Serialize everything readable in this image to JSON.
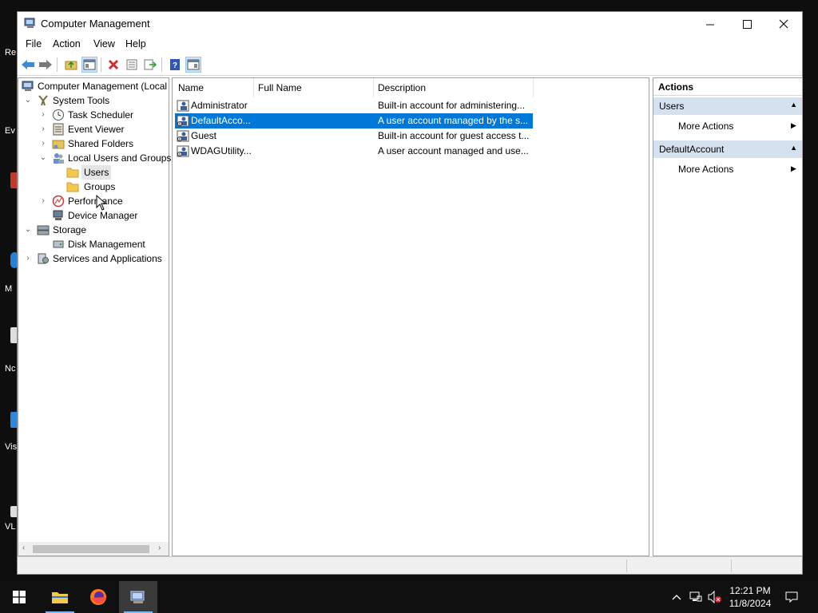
{
  "desktop": {
    "labels": [
      "Re",
      "Ev",
      "M",
      "Nc",
      "Vis",
      "VL"
    ]
  },
  "window": {
    "title": "Computer Management",
    "controls": {
      "minimize": "—",
      "maximize": "☐",
      "close": "✕"
    }
  },
  "menu": [
    "File",
    "Action",
    "View",
    "Help"
  ],
  "tree": {
    "root": "Computer Management (Local",
    "system_tools": "System Tools",
    "task_scheduler": "Task Scheduler",
    "event_viewer": "Event Viewer",
    "shared_folders": "Shared Folders",
    "local_users_groups": "Local Users and Groups",
    "users": "Users",
    "groups": "Groups",
    "performance": "Performance",
    "device_manager": "Device Manager",
    "storage": "Storage",
    "disk_management": "Disk Management",
    "services_apps": "Services and Applications"
  },
  "list": {
    "columns": {
      "name": "Name",
      "full_name": "Full Name",
      "description": "Description"
    },
    "rows": [
      {
        "name": "Administrator",
        "full_name": "",
        "description": "Built-in account for administering...",
        "selected": false
      },
      {
        "name": "DefaultAcco...",
        "full_name": "",
        "description": "A user account managed by the s...",
        "selected": true
      },
      {
        "name": "Guest",
        "full_name": "",
        "description": "Built-in account for guest access t...",
        "selected": false
      },
      {
        "name": "WDAGUtility...",
        "full_name": "",
        "description": "A user account managed and use...",
        "selected": false
      }
    ]
  },
  "actions": {
    "title": "Actions",
    "sections": [
      {
        "header": "Users",
        "item": "More Actions"
      },
      {
        "header": "DefaultAccount",
        "item": "More Actions"
      }
    ]
  },
  "taskbar": {
    "time": "12:21 PM",
    "date": "11/8/2024"
  },
  "colors": {
    "selection": "#0078d7",
    "section_header": "#d5e1ee",
    "folder": "#f2c94c"
  }
}
